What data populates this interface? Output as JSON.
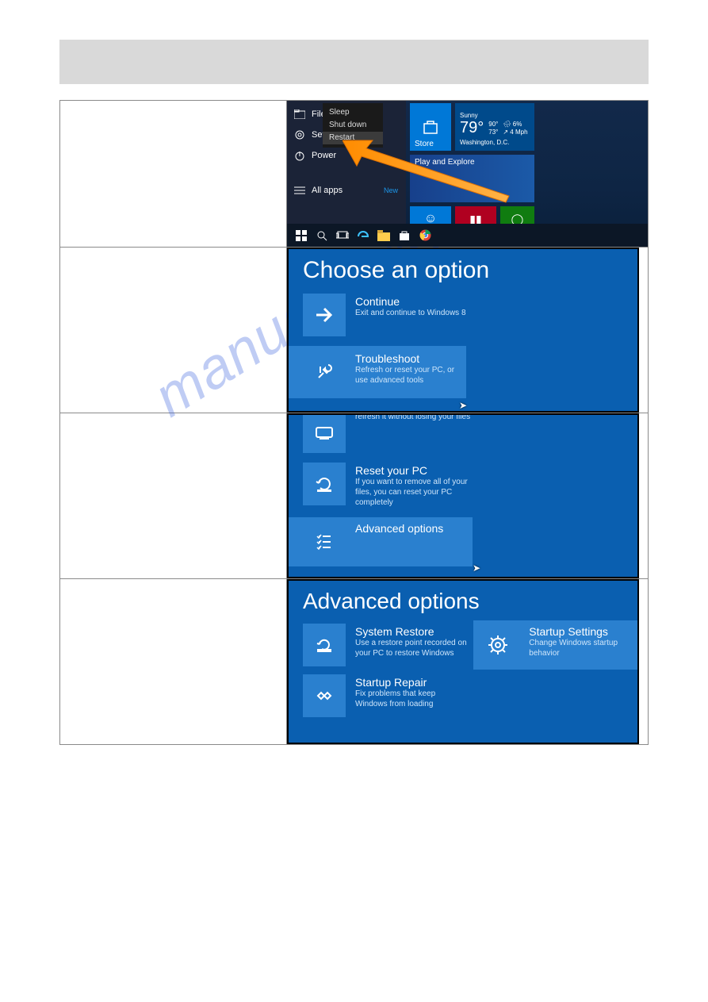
{
  "watermark": "manualslive.com",
  "row1": {
    "start_items": {
      "file_explorer": "File Ex",
      "settings": "Setting",
      "power": "Power",
      "all_apps": "All apps",
      "new": "New"
    },
    "power_menu": {
      "sleep": "Sleep",
      "shutdown": "Shut down",
      "restart": "Restart"
    },
    "tiles": {
      "store": "Store",
      "weather": {
        "cond": "Sunny",
        "temp": "79°",
        "hi": "90°",
        "lo": "73°",
        "humid": "6%",
        "wind": "4 Mph",
        "city": "Washington, D.C."
      },
      "play": "Play and Explore"
    }
  },
  "row2": {
    "title": "Choose an option",
    "continue": {
      "title": "Continue",
      "sub": "Exit and continue to Windows 8"
    },
    "troubleshoot": {
      "title": "Troubleshoot",
      "sub": "Refresh or reset your PC, or use advanced tools"
    }
  },
  "row3": {
    "refresh_sub": "refresh it without losing your files",
    "reset": {
      "title": "Reset your PC",
      "sub": "If you want to remove all of your files, you can reset your PC completely"
    },
    "advanced": {
      "title": "Advanced options"
    }
  },
  "row4": {
    "title": "Advanced options",
    "system_restore": {
      "title": "System Restore",
      "sub": "Use a restore point recorded on your PC to restore Windows"
    },
    "startup_repair": {
      "title": "Startup Repair",
      "sub": "Fix problems that keep Windows from loading"
    },
    "startup_settings": {
      "title": "Startup Settings",
      "sub": "Change Windows startup behavior"
    }
  }
}
